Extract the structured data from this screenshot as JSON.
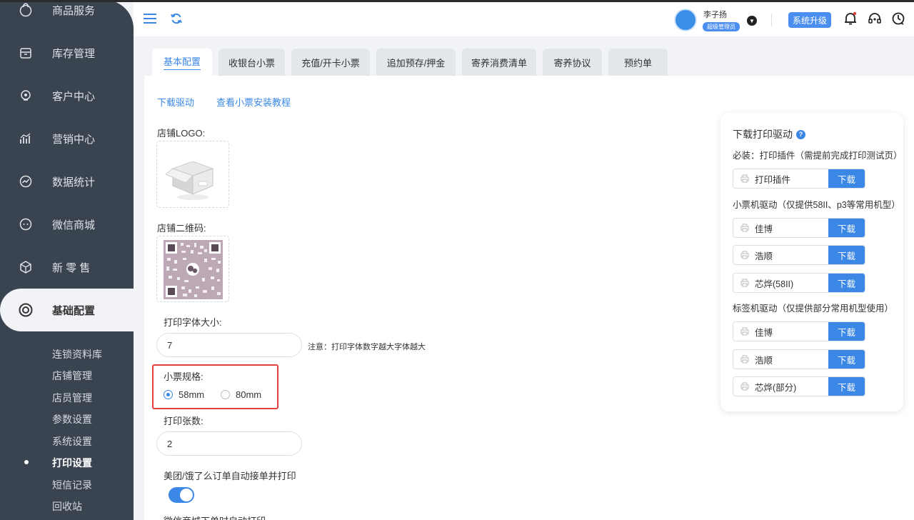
{
  "sidebar": {
    "menu": [
      {
        "label": "商品服务",
        "icon": "shopping-bag-icon"
      },
      {
        "label": "库存管理",
        "icon": "inventory-box-icon"
      },
      {
        "label": "客户中心",
        "icon": "customer-icon"
      },
      {
        "label": "营销中心",
        "icon": "marketing-chart-icon"
      },
      {
        "label": "数据统计",
        "icon": "statistics-icon"
      },
      {
        "label": "微信商城",
        "icon": "wechat-mall-icon"
      },
      {
        "label": "新 零 售",
        "icon": "new-retail-cube-icon"
      },
      {
        "label": "基础配置",
        "icon": "settings-ring-icon",
        "active": true
      }
    ],
    "submenu": [
      {
        "label": "连锁资料库"
      },
      {
        "label": "店铺管理"
      },
      {
        "label": "店员管理"
      },
      {
        "label": "参数设置"
      },
      {
        "label": "系统设置"
      },
      {
        "label": "打印设置",
        "active": true
      },
      {
        "label": "短信记录"
      },
      {
        "label": "回收站"
      }
    ]
  },
  "header": {
    "user_name": "李子扬",
    "user_role": "超级管理员",
    "upgrade_label": "系统升级"
  },
  "tabs": [
    {
      "label": "基本配置",
      "active": true
    },
    {
      "label": "收银台小票"
    },
    {
      "label": "充值/开卡小票"
    },
    {
      "label": "追加预存/押金"
    },
    {
      "label": "寄养消费清单"
    },
    {
      "label": "寄养协议"
    },
    {
      "label": "预约单"
    }
  ],
  "main": {
    "link_download_driver": "下载驱动",
    "link_tutorial": "查看小票安装教程",
    "logo_label": "店铺LOGO:",
    "qr_label": "店铺二维码:",
    "font_size_label": "打印字体大小:",
    "font_size_value": "7",
    "font_size_note": "注意：打印字体数字越大字体越大",
    "receipt_spec_label": "小票规格:",
    "spec_options": [
      {
        "label": "58mm",
        "checked": true
      },
      {
        "label": "80mm",
        "checked": false
      }
    ],
    "copies_label": "打印张数:",
    "copies_value": "2",
    "auto_print_label": "美团/饿了么订单自动接单并打印",
    "auto_print_enabled": true,
    "cut_text": "微信商城下单时自动打印"
  },
  "driver_panel": {
    "title": "下载打印驱动",
    "required_label": "必装：打印插件（需提前完成打印测试页）",
    "plugin_name": "打印插件",
    "receipt_section": "小票机驱动（仅提供58II、p3等常用机型）",
    "receipt_drivers": [
      "佳博",
      "浩顺",
      "芯烨(58II)"
    ],
    "label_section": "标签机驱动（仅提供部分常用机型使用）",
    "label_drivers": [
      "佳博",
      "浩顺",
      "芯烨(部分)"
    ],
    "download_label": "下载"
  },
  "colors": {
    "sidebar_bg": "#3a4350",
    "accent": "#3a87e6",
    "highlight": "#e0413a"
  }
}
